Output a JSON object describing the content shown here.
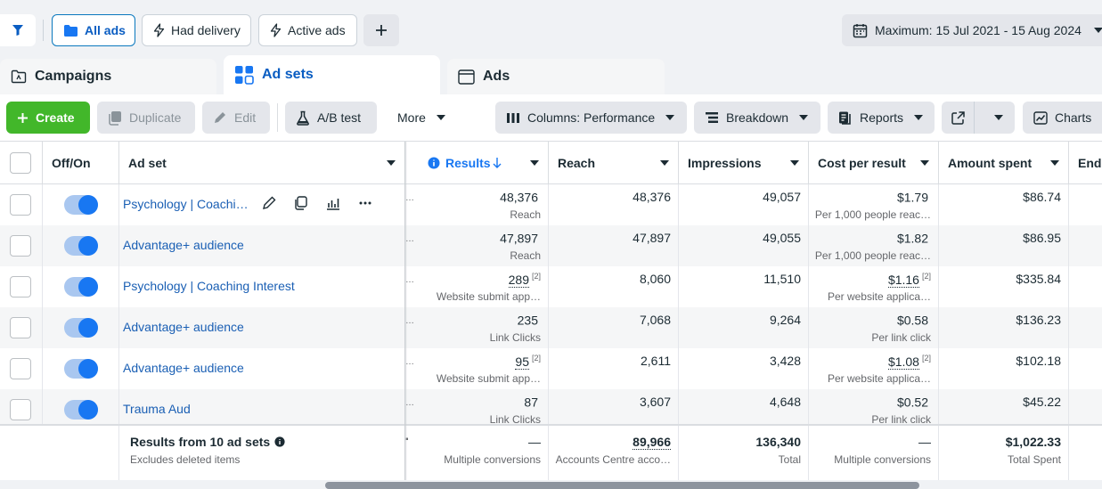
{
  "topbar": {
    "filters": [
      {
        "label": "All ads",
        "selected": true
      },
      {
        "label": "Had delivery",
        "selected": false
      },
      {
        "label": "Active ads",
        "selected": false
      }
    ],
    "date_range": "Maximum: 15 Jul 2021 - 15 Aug 2024"
  },
  "tabs": [
    {
      "label": "Campaigns",
      "active": false
    },
    {
      "label": "Ad sets",
      "active": true
    },
    {
      "label": "Ads",
      "active": false
    }
  ],
  "toolbar": {
    "create": "Create",
    "duplicate": "Duplicate",
    "edit": "Edit",
    "ab_test": "A/B test",
    "more": "More",
    "columns": "Columns: Performance",
    "breakdown": "Breakdown",
    "reports": "Reports",
    "charts": "Charts"
  },
  "headers": {
    "off_on": "Off/On",
    "ad_set": "Ad set",
    "results": "Results",
    "reach": "Reach",
    "impressions": "Impressions",
    "cost_per_result": "Cost per result",
    "amount_spent": "Amount spent",
    "ends": "Ends"
  },
  "rows": [
    {
      "name": "Psychology | Coachi…",
      "results": "48,376",
      "results_sub": "Reach",
      "results_sup": "",
      "reach": "48,376",
      "impressions": "49,057",
      "cost": "$1.79",
      "cost_sub": "Per 1,000 people reac…",
      "cost_sup": "",
      "spent": "$86.74"
    },
    {
      "name": "Advantage+ audience",
      "results": "47,897",
      "results_sub": "Reach",
      "results_sup": "",
      "reach": "47,897",
      "impressions": "49,055",
      "cost": "$1.82",
      "cost_sub": "Per 1,000 people reac…",
      "cost_sup": "",
      "spent": "$86.95"
    },
    {
      "name": "Psychology | Coaching Interest",
      "results": "289",
      "results_sub": "Website submit app…",
      "results_sup": "[2]",
      "reach": "8,060",
      "impressions": "11,510",
      "cost": "$1.16",
      "cost_sub": "Per website applica…",
      "cost_sup": "[2]",
      "spent": "$335.84"
    },
    {
      "name": "Advantage+ audience",
      "results": "235",
      "results_sub": "Link Clicks",
      "results_sup": "",
      "reach": "7,068",
      "impressions": "9,264",
      "cost": "$0.58",
      "cost_sub": "Per link click",
      "cost_sup": "",
      "spent": "$136.23"
    },
    {
      "name": "Advantage+ audience",
      "results": "95",
      "results_sub": "Website submit app…",
      "results_sup": "[2]",
      "reach": "2,611",
      "impressions": "3,428",
      "cost": "$1.08",
      "cost_sub": "Per website applica…",
      "cost_sup": "[2]",
      "spent": "$102.18"
    },
    {
      "name": "Trauma Aud",
      "results": "87",
      "results_sub": "Link Clicks",
      "results_sup": "",
      "reach": "3,607",
      "impressions": "4,648",
      "cost": "$0.52",
      "cost_sub": "Per link click",
      "cost_sup": "",
      "spent": "$45.22"
    }
  ],
  "footer": {
    "title": "Results from 10 ad sets",
    "subtitle": "Excludes deleted items",
    "results": "—",
    "results_sub": "Multiple conversions",
    "reach": "89,966",
    "reach_sub": "Accounts Centre acco…",
    "impressions": "136,340",
    "impressions_sub": "Total",
    "cost": "—",
    "cost_sub": "Multiple conversions",
    "spent": "$1,022.33",
    "spent_sub": "Total Spent"
  },
  "colors": {
    "accent": "#1877f2",
    "create": "#42b72a",
    "link": "#1a5fb4"
  }
}
